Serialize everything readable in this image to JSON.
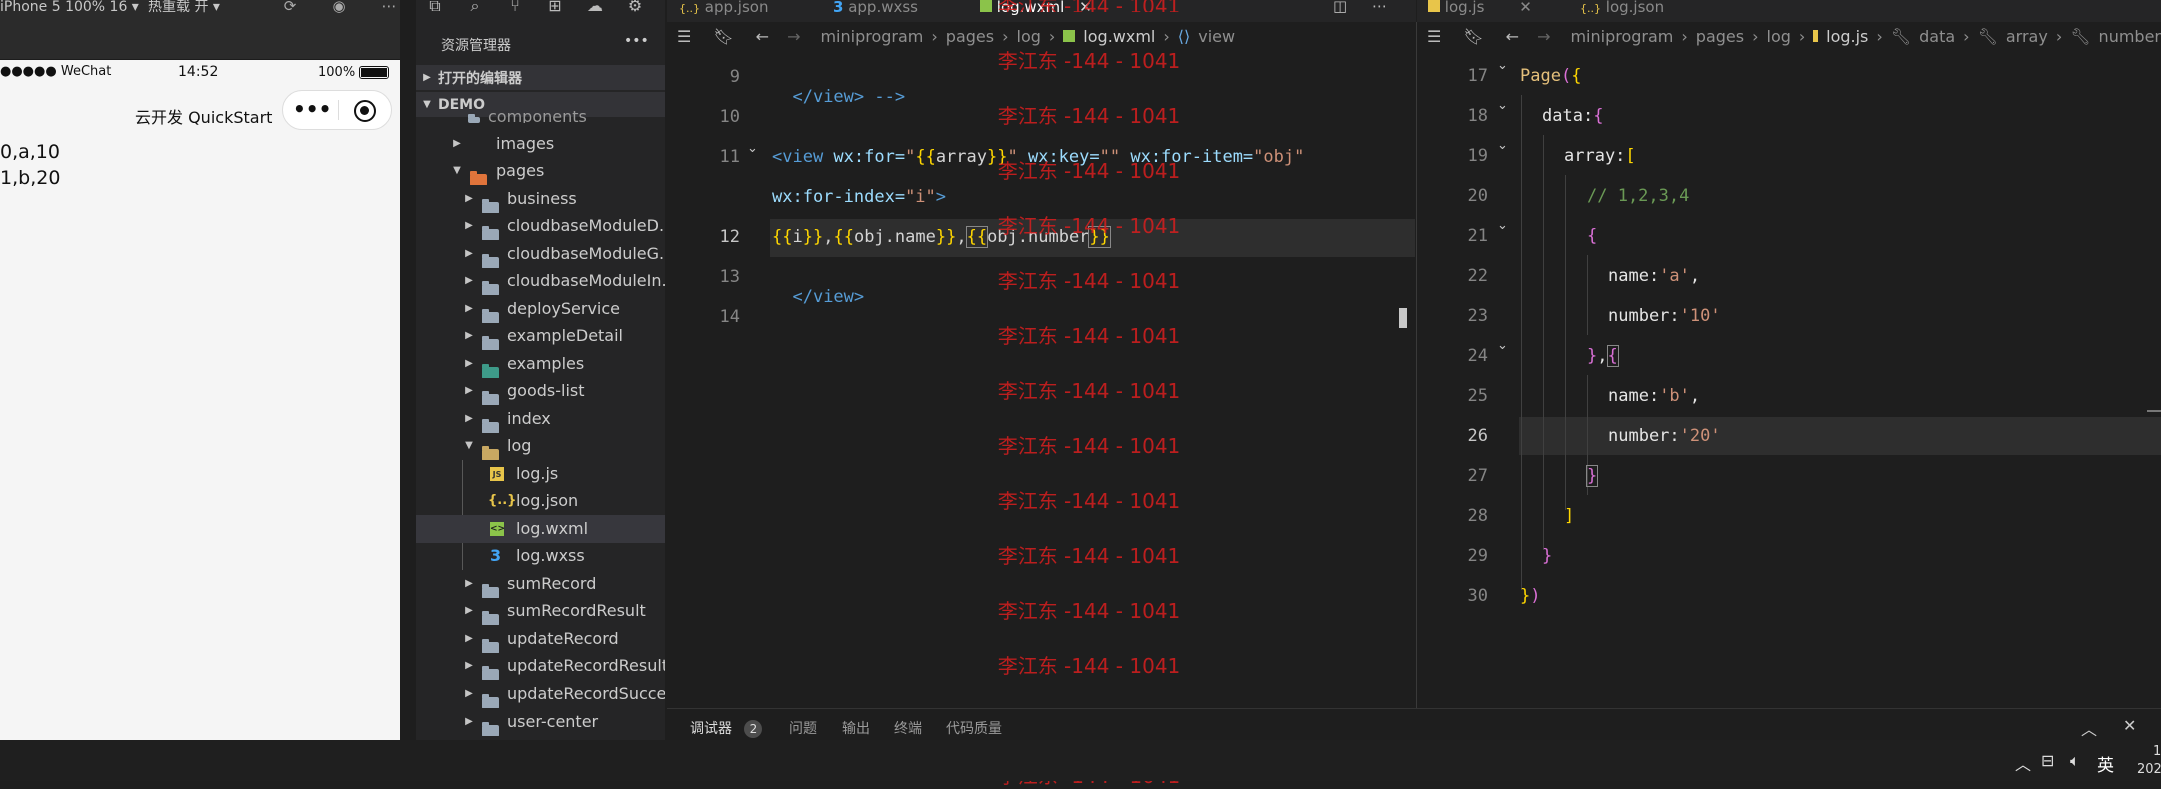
{
  "simulator": {
    "device": "iPhone 5 100% 16 ▾",
    "hot_reload": "热重载 开 ▾",
    "status_bar": {
      "signal": "●●●●● WeChat",
      "time": "14:52",
      "battery": "100%"
    },
    "nav_title": "云开发 QuickStart",
    "capsule_more": "•••",
    "content_lines": [
      "0,a,10",
      "1,b,20"
    ]
  },
  "explorer": {
    "title": "资源管理器",
    "more": "•••",
    "open_editors": "打开的编辑器",
    "project": "DEMO",
    "items": [
      {
        "label": "components",
        "kind": "folder-partial"
      },
      {
        "label": "images",
        "kind": "folder-teal"
      },
      {
        "label": "pages",
        "kind": "folder-open-orange"
      },
      {
        "label": "business",
        "kind": "folder"
      },
      {
        "label": "cloudbaseModuleD...",
        "kind": "folder"
      },
      {
        "label": "cloudbaseModuleG...",
        "kind": "folder"
      },
      {
        "label": "cloudbaseModuleIn...",
        "kind": "folder"
      },
      {
        "label": "deployService",
        "kind": "folder"
      },
      {
        "label": "exampleDetail",
        "kind": "folder"
      },
      {
        "label": "examples",
        "kind": "folder-teal"
      },
      {
        "label": "goods-list",
        "kind": "folder"
      },
      {
        "label": "index",
        "kind": "folder"
      },
      {
        "label": "log",
        "kind": "folder-open"
      },
      {
        "label": "log.js",
        "kind": "js"
      },
      {
        "label": "log.json",
        "kind": "json"
      },
      {
        "label": "log.wxml",
        "kind": "wxml"
      },
      {
        "label": "log.wxss",
        "kind": "wxss"
      },
      {
        "label": "sumRecord",
        "kind": "folder"
      },
      {
        "label": "sumRecordResult",
        "kind": "folder"
      },
      {
        "label": "updateRecord",
        "kind": "folder"
      },
      {
        "label": "updateRecordResult",
        "kind": "folder"
      },
      {
        "label": "updateRecordSuccess",
        "kind": "folder"
      },
      {
        "label": "user-center",
        "kind": "folder"
      }
    ]
  },
  "editor_left": {
    "tabs": [
      "app.json",
      "app.wxss",
      "log.wxml"
    ],
    "breadcrumb": [
      "miniprogram",
      "pages",
      "log",
      "log.wxml",
      "view"
    ],
    "line_numbers": [
      "9",
      "10",
      "11",
      "",
      "12",
      "13",
      "14"
    ],
    "lines": {
      "l9": "</view> -->",
      "l11a_tag": "<view ",
      "l11a_attr1": "wx:for=",
      "l11a_str1a": "\"",
      "l11a_b1": "{{",
      "l11a_v1": "array",
      "l11a_b2": "}}",
      "l11a_str1b": "\"",
      "l11a_attr2": " wx:key=",
      "l11a_str2": "\"\"",
      "l11a_attr3": " wx:for-item=",
      "l11a_str3": "\"obj\"",
      "l11b_attr": "wx:for-index=",
      "l11b_str": "\"i\"",
      "l11b_tag": ">",
      "l12_b1": "{{",
      "l12_v1": "i",
      "l12_b2": "}}",
      "l12_c1": ",",
      "l12_b3": "{{",
      "l12_v2": "obj.name",
      "l12_b4": "}}",
      "l12_c2": ",",
      "l12_b5": "{{",
      "l12_v3": "obj.number",
      "l12_b6": "}}",
      "l13": "</view>"
    }
  },
  "editor_right": {
    "tabs": [
      "log.js",
      "log.json"
    ],
    "breadcrumb": [
      "miniprogram",
      "pages",
      "log",
      "log.js",
      "data",
      "array",
      "number"
    ],
    "line_numbers": [
      "17",
      "18",
      "19",
      "20",
      "21",
      "22",
      "23",
      "24",
      "25",
      "26",
      "27",
      "28",
      "29",
      "30"
    ],
    "lines": {
      "l17_fn": "Page",
      "l17_p": "(",
      "l17_b": "{",
      "l18_k": "data:",
      "l18_b": "{",
      "l19_k": "array:",
      "l19_b": "[",
      "l20": "// 1,2,3,4",
      "l21": "{",
      "l22_k": "name:",
      "l22_s": "'a'",
      "l22_c": ",",
      "l23_k": "number:",
      "l23_s": "'10'",
      "l24_a": "}",
      "l24_c": ",",
      "l24_b": "{",
      "l25_k": "name:",
      "l25_s": "'b'",
      "l25_c": ",",
      "l26_k": "number:",
      "l26_s": "'20'",
      "l27": "}",
      "l28": "]",
      "l29": "}",
      "l30_b": "}",
      "l30_p": ")"
    }
  },
  "watermark": "李江东 -144 - 1041",
  "panel": {
    "tabs": [
      "调试器",
      "问题",
      "输出",
      "终端",
      "代码质量"
    ],
    "debugger_badge": "2"
  },
  "taskbar": {
    "ime": "英",
    "clock_partial": "1",
    "date_partial": "202"
  },
  "colors": {
    "background": "#1e1e1e",
    "sidebar": "#252526",
    "watermark": "#d81e1e",
    "selection": "#37373d",
    "phone_background": "#f5f5f5"
  }
}
